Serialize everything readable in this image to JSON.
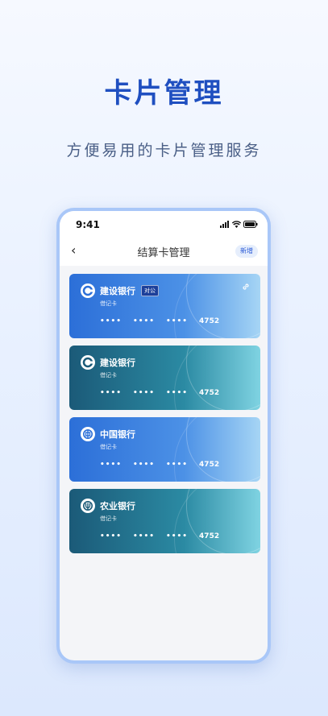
{
  "hero": {
    "title": "卡片管理",
    "subtitle": "方便易用的卡片管理服务"
  },
  "status_bar": {
    "time": "9:41"
  },
  "nav": {
    "title": "结算卡管理",
    "add_label": "新增"
  },
  "cards": [
    {
      "bank": "建设银行",
      "tag": "对公",
      "type": "借记卡",
      "mask": "••••",
      "last4": "4752",
      "style": "blue",
      "logo": "ccb-logo-icon"
    },
    {
      "bank": "建设银行",
      "tag": "",
      "type": "借记卡",
      "mask": "••••",
      "last4": "4752",
      "style": "teal",
      "logo": "ccb-logo-icon"
    },
    {
      "bank": "中国银行",
      "tag": "",
      "type": "借记卡",
      "mask": "••••",
      "last4": "4752",
      "style": "blue",
      "logo": "boc-logo-icon"
    },
    {
      "bank": "农业银行",
      "tag": "",
      "type": "借记卡",
      "mask": "••••",
      "last4": "4752",
      "style": "teal",
      "logo": "abc-logo-icon"
    }
  ],
  "colors": {
    "headline": "#1f4fc0",
    "card_blue": "#2c6fd8",
    "card_teal": "#1b5a78"
  }
}
